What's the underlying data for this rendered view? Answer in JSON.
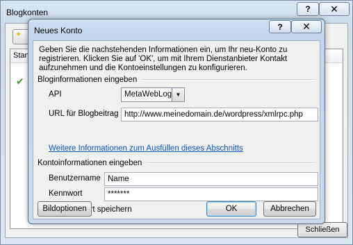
{
  "background_window": {
    "title": "Blogkonten",
    "column_header": "Stand",
    "close_button_label": "Schließen"
  },
  "dialog": {
    "title": "Neues Konto",
    "intro": "Geben Sie die nachstehenden Informationen ein, um Ihr neu-Konto zu registrieren. Klicken Sie auf 'OK', um mit Ihrem Dienstanbieter Kontakt aufzunehmen und die Kontoeinstellungen zu konfigurieren.",
    "blog_section": "Bloginformationen eingeben",
    "api_label": "API",
    "api_value": "MetaWebLog",
    "url_label": "URL für Blogbeitrag",
    "url_value": "http://www.meinedomain.de/wordpress/xmlrpc.php",
    "more_info_link": "Weitere Informationen zum Ausfüllen dieses Abschnitts",
    "account_section": "Kontoinformationen eingeben",
    "username_label": "Benutzername",
    "username_value": "Name",
    "password_label": "Kennwort",
    "password_value": "*******",
    "save_password_label": "Kennwort speichern",
    "save_password_checked": false,
    "image_options_button": "Bildoptionen",
    "ok_button": "OK",
    "cancel_button": "Abbrechen"
  },
  "icons": {
    "help": "?",
    "close": "✕",
    "checkmark": "✔",
    "dropdown": "▼"
  },
  "colors": {
    "link": "#0b55b8",
    "check": "#3a9b2e"
  }
}
